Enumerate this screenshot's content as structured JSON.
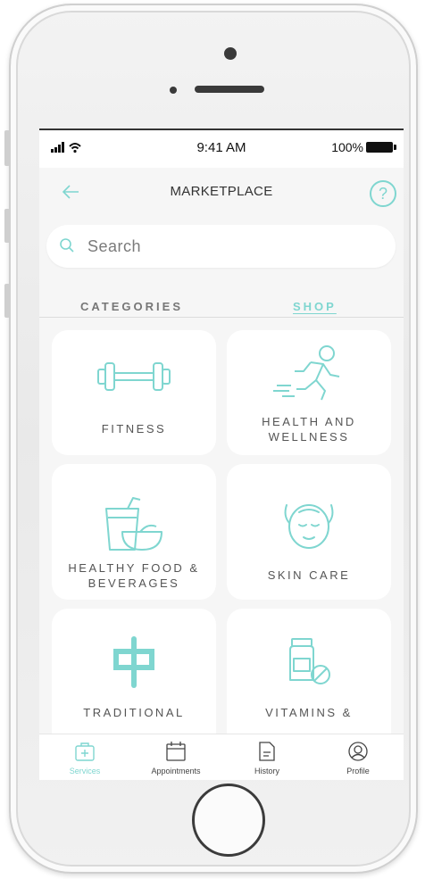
{
  "status_bar": {
    "time": "9:41 AM",
    "battery": "100%"
  },
  "header": {
    "title": "MARKETPLACE"
  },
  "search": {
    "placeholder": "Search"
  },
  "tabs": [
    {
      "label": "CATEGORIES",
      "active": false
    },
    {
      "label": "SHOP",
      "active": true
    }
  ],
  "categories": [
    {
      "label": "FITNESS",
      "icon": "dumbbell-icon"
    },
    {
      "label": "HEALTH AND WELLNESS",
      "icon": "running-person-icon"
    },
    {
      "label": "HEALTHY FOOD & BEVERAGES",
      "icon": "food-drink-icon"
    },
    {
      "label": "SKIN CARE",
      "icon": "face-mask-icon"
    },
    {
      "label": "TRADITIONAL",
      "icon": "chinese-character-icon",
      "icon_glyph": "中"
    },
    {
      "label": "VITAMINS &",
      "icon": "vitamin-bottle-icon"
    }
  ],
  "tab_bar": [
    {
      "label": "Services",
      "icon": "medical-kit-icon",
      "active": true
    },
    {
      "label": "Appointments",
      "icon": "calendar-icon",
      "active": false
    },
    {
      "label": "History",
      "icon": "document-icon",
      "active": false
    },
    {
      "label": "Profile",
      "icon": "user-circle-icon",
      "active": false
    }
  ],
  "colors": {
    "accent": "#7fd6d0",
    "background": "#f6f6f6",
    "card": "#ffffff"
  }
}
